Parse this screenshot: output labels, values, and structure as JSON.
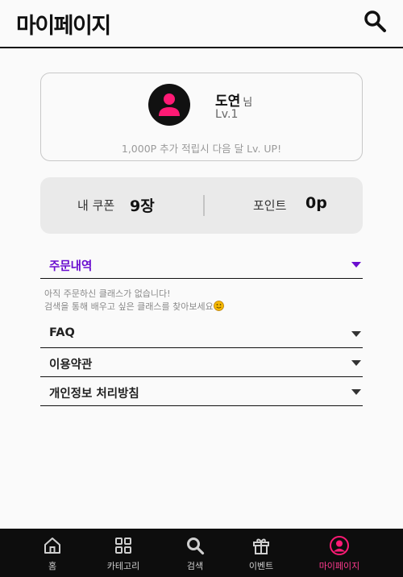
{
  "header": {
    "title": "마이페이지",
    "search_icon": "search-icon"
  },
  "profile": {
    "name": "도연",
    "suffix": "님",
    "level": "Lv.1",
    "notice": "1,000P 추가 적립시 다음 달 Lv. UP!",
    "avatar_icon": "user-icon",
    "avatar_color": "#ff1a75"
  },
  "stats": {
    "coupon_label": "내 쿠폰",
    "coupon_value": "9장",
    "point_label": "포인트",
    "point_value": "0p"
  },
  "accordion": [
    {
      "label": "주문내역",
      "expanded": true
    },
    {
      "label": "FAQ",
      "expanded": false
    },
    {
      "label": "이용약관",
      "expanded": false
    },
    {
      "label": "개인정보 처리방침",
      "expanded": false
    }
  ],
  "order_history": {
    "empty_line1": "아직 주문하신 클래스가 없습니다!",
    "empty_line2": "검색을 통해 배우고 싶은 클래스를 찾아보세요",
    "emoji_icon": "smiley-icon"
  },
  "bottom_nav": [
    {
      "label": "홈",
      "icon": "home-icon"
    },
    {
      "label": "카테고리",
      "icon": "grid-icon"
    },
    {
      "label": "검색",
      "icon": "search-icon"
    },
    {
      "label": "이벤트",
      "icon": "gift-icon"
    },
    {
      "label": "마이페이지",
      "icon": "profile-icon",
      "active": true
    }
  ],
  "colors": {
    "accent_purple": "#6a0dcf",
    "accent_pink": "#ff1a75",
    "nav_bg": "#0d0d0d"
  }
}
